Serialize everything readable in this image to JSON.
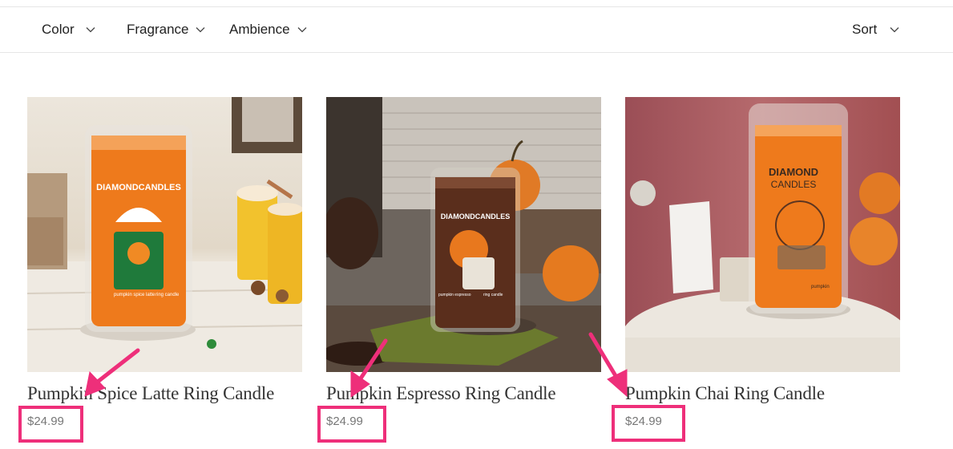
{
  "filters": {
    "color_label": "Color",
    "fragrance_label": "Fragrance",
    "ambience_label": "Ambience",
    "sort_label": "Sort"
  },
  "products": [
    {
      "title": "Pumpkin Spice Latte Ring Candle",
      "price": "$24.99",
      "jar_brand": "DIAMONDCANDLES",
      "jar_caption": "pumpkin spice latte",
      "jar_type": "ring candle"
    },
    {
      "title": "Pumpkin Espresso Ring Candle",
      "price": "$24.99",
      "jar_brand": "DIAMONDCANDLES",
      "jar_caption": "pumpkin espresso",
      "jar_type": "ring candle"
    },
    {
      "title": "Pumpkin Chai Ring Candle",
      "price": "$24.99",
      "jar_brand_line1": "DIAMOND",
      "jar_brand_line2": "CANDLES",
      "jar_caption": "pumpkin"
    }
  ],
  "colors": {
    "annotation": "#ee2f7a",
    "candle_orange": "#ee7a1c",
    "espresso_brown": "#5a2e1c"
  }
}
